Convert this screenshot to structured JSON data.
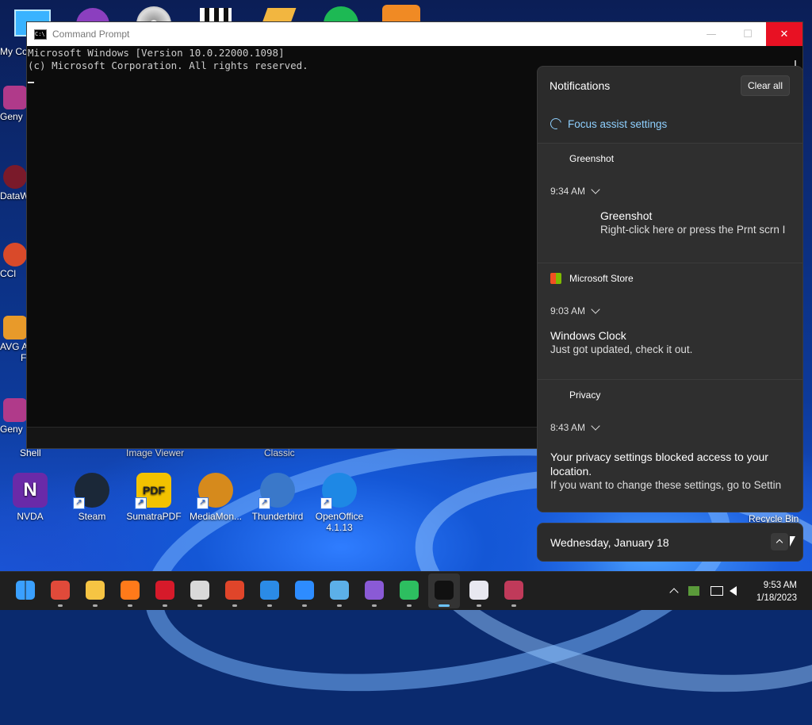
{
  "desktop": {
    "top_icons": [
      {
        "name": "monitor"
      },
      {
        "name": "purple-app"
      },
      {
        "name": "disc"
      },
      {
        "name": "clapper"
      },
      {
        "name": "pen"
      },
      {
        "name": "spotify"
      },
      {
        "name": "orange-app"
      }
    ],
    "left_icons": [
      {
        "label": "My Co"
      },
      {
        "label": "Geny"
      },
      {
        "label": "DataW"
      },
      {
        "label": "CCl"
      },
      {
        "label": "AVG A"
      },
      {
        "label": "F"
      },
      {
        "label": "Geny"
      }
    ],
    "row_partial_labels": {
      "shell": "Shell",
      "image_viewer": "Image Viewer",
      "classic": "Classic"
    },
    "bottom_icons": [
      {
        "label": "NVDA",
        "icon": "nvda-icon",
        "color": "#6a2aa8"
      },
      {
        "label": "Steam",
        "icon": "steam-icon",
        "color": "#1b2838"
      },
      {
        "label": "SumatraPDF",
        "icon": "pdf-icon",
        "color": "#f2c200"
      },
      {
        "label": "MediaMon...",
        "icon": "media-monkey-icon",
        "color": "#d68a1c"
      },
      {
        "label": "Thunderbird",
        "icon": "thunderbird-icon",
        "color": "#3a78c9"
      },
      {
        "label": "OpenOffice 4.1.13",
        "icon": "openoffice-icon",
        "color": "#1e88e5"
      }
    ],
    "recycle_bin_label": "Recycle Bin"
  },
  "cmd": {
    "title": "Command Prompt",
    "icon_text": "C:\\",
    "lines": [
      "Microsoft Windows [Version 10.0.22000.1098]",
      "(c) Microsoft Corporation. All rights reserved."
    ],
    "buttons": {
      "minimize": "—",
      "maximize": "☐",
      "close": "✕"
    }
  },
  "notifications": {
    "header": "Notifications",
    "clear_all": "Clear all",
    "focus_assist": "Focus assist settings",
    "groups": [
      {
        "source": "Greenshot",
        "time": "9:34 AM",
        "title": "Greenshot",
        "body": "Right-click here or press the Prnt scrn I"
      },
      {
        "source": "Microsoft Store",
        "time": "9:03 AM",
        "title": "Windows Clock",
        "body": "Just got updated, check it out."
      },
      {
        "source": "Privacy",
        "time": "8:43 AM",
        "title": "Your privacy settings blocked access to your location.",
        "body": "If you want to change these settings, go to Settin"
      }
    ]
  },
  "calendar": {
    "date": "Wednesday, January 18"
  },
  "taskbar": {
    "apps": [
      {
        "name": "start-icon",
        "color": "#3aa0ff"
      },
      {
        "name": "chrome-icon",
        "color": "#e04a3a"
      },
      {
        "name": "file-explorer-icon",
        "color": "#f6c443"
      },
      {
        "name": "firefox-icon",
        "color": "#ff7a1a"
      },
      {
        "name": "opera-icon",
        "color": "#d61a2a"
      },
      {
        "name": "clock-app-icon",
        "color": "#d9d9d9"
      },
      {
        "name": "ccleaner-icon",
        "color": "#e0452a"
      },
      {
        "name": "vscode-icon",
        "color": "#2b8be6"
      },
      {
        "name": "zoom-icon",
        "color": "#2d8cff"
      },
      {
        "name": "paint-icon",
        "color": "#5cb0e8"
      },
      {
        "name": "github-icon",
        "color": "#8a5ad6"
      },
      {
        "name": "evernote-icon",
        "color": "#2dbe60"
      },
      {
        "name": "terminal-icon",
        "color": "#111111"
      },
      {
        "name": "itunes-icon",
        "color": "#e8e8f0"
      },
      {
        "name": "photo-app-icon",
        "color": "#c03a5a"
      }
    ],
    "time": "9:53 AM",
    "date": "1/18/2023"
  }
}
